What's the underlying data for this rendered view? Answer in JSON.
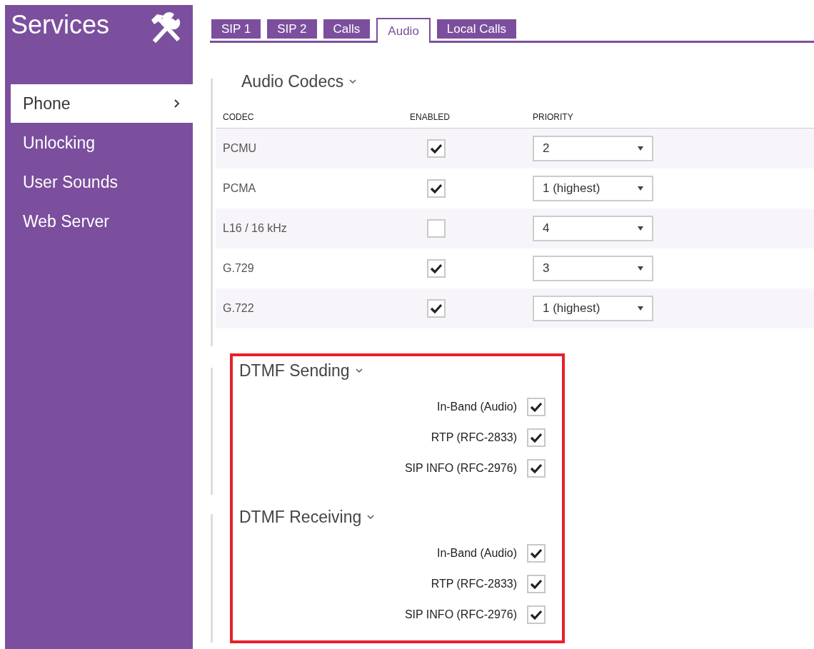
{
  "sidebar": {
    "title": "Services",
    "items": [
      {
        "label": "Phone",
        "selected": true
      },
      {
        "label": "Unlocking",
        "selected": false
      },
      {
        "label": "User Sounds",
        "selected": false
      },
      {
        "label": "Web Server",
        "selected": false
      }
    ]
  },
  "tabs": [
    {
      "label": "SIP 1",
      "selected": false
    },
    {
      "label": "SIP 2",
      "selected": false
    },
    {
      "label": "Calls",
      "selected": false
    },
    {
      "label": "Audio",
      "selected": true
    },
    {
      "label": "Local Calls",
      "selected": false
    }
  ],
  "audio_codecs": {
    "title": "Audio Codecs",
    "columns": [
      "CODEC",
      "ENABLED",
      "PRIORITY"
    ],
    "rows": [
      {
        "codec": "PCMU",
        "checked": true,
        "priority": "2"
      },
      {
        "codec": "PCMA",
        "checked": true,
        "priority": "1 (highest)"
      },
      {
        "codec": "L16 / 16 kHz",
        "checked": false,
        "priority": "4"
      },
      {
        "codec": "G.729",
        "checked": true,
        "priority": "3"
      },
      {
        "codec": "G.722",
        "checked": true,
        "priority": "1 (highest)"
      }
    ]
  },
  "dtmf_sections": [
    {
      "title": "DTMF Sending",
      "options": [
        {
          "label": "In-Band (Audio)",
          "checked": true
        },
        {
          "label": "RTP (RFC-2833)",
          "checked": true
        },
        {
          "label": "SIP INFO (RFC-2976)",
          "checked": true
        }
      ]
    },
    {
      "title": "DTMF Receiving",
      "options": [
        {
          "label": "In-Band (Audio)",
          "checked": true
        },
        {
          "label": "RTP (RFC-2833)",
          "checked": true
        },
        {
          "label": "SIP INFO (RFC-2976)",
          "checked": true
        }
      ]
    }
  ]
}
